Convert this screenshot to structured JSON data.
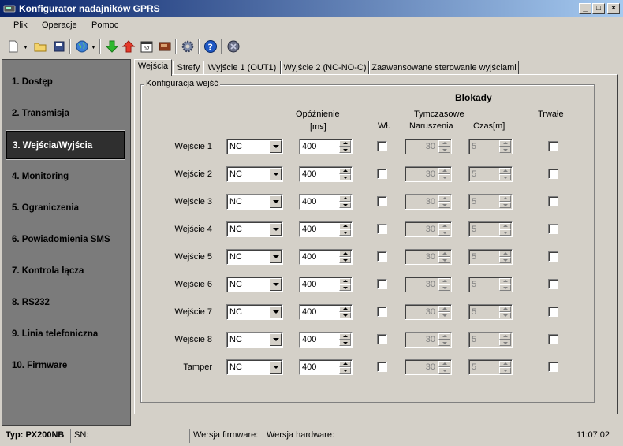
{
  "window": {
    "title": "Konfigurator nadajników GPRS",
    "minimize": "_",
    "maximize": "□",
    "close": "×"
  },
  "menu": [
    "Plik",
    "Operacje",
    "Pomoc"
  ],
  "toolbar": {
    "icons": [
      "new-document-icon",
      "open-folder-icon",
      "save-icon",
      "connect-globe-icon",
      "download-arrow-icon",
      "upload-arrow-icon",
      "calendar-icon",
      "device-icon",
      "settings-gear-icon",
      "help-icon",
      "exit-icon"
    ]
  },
  "sidebar": {
    "items": [
      "1. Dostęp",
      "2. Transmisja",
      "3. Wejścia/Wyjścia",
      "4. Monitoring",
      "5. Ograniczenia",
      "6. Powiadomienia SMS",
      "7. Kontrola łącza",
      "8. RS232",
      "9. Linia telefoniczna",
      "10. Firmware"
    ],
    "active_index": 2
  },
  "tabs": [
    "Wejścia",
    "Strefy",
    "Wyjście 1 (OUT1)",
    "Wyjście 2 (NC-NO-C)",
    "Zaawansowane sterowanie wyjściami"
  ],
  "panel": {
    "group_title": "Konfiguracja wejść",
    "headers": {
      "blokady": "Blokady",
      "opoznienie": "Opóźnienie",
      "ms": "[ms]",
      "wl": "Wł.",
      "tymczasowe": "Tymczasowe",
      "naruszenia": "Naruszenia",
      "czas": "Czas[m]",
      "trwale": "Trwałe"
    },
    "rows": [
      {
        "label": "Wejście 1",
        "type": "NC",
        "delay": "400",
        "naruszenia": "30",
        "czas": "5"
      },
      {
        "label": "Wejście 2",
        "type": "NC",
        "delay": "400",
        "naruszenia": "30",
        "czas": "5"
      },
      {
        "label": "Wejście 3",
        "type": "NC",
        "delay": "400",
        "naruszenia": "30",
        "czas": "5"
      },
      {
        "label": "Wejście 4",
        "type": "NC",
        "delay": "400",
        "naruszenia": "30",
        "czas": "5"
      },
      {
        "label": "Wejście 5",
        "type": "NC",
        "delay": "400",
        "naruszenia": "30",
        "czas": "5"
      },
      {
        "label": "Wejście 6",
        "type": "NC",
        "delay": "400",
        "naruszenia": "30",
        "czas": "5"
      },
      {
        "label": "Wejście 7",
        "type": "NC",
        "delay": "400",
        "naruszenia": "30",
        "czas": "5"
      },
      {
        "label": "Wejście 8",
        "type": "NC",
        "delay": "400",
        "naruszenia": "30",
        "czas": "5"
      },
      {
        "label": "Tamper",
        "type": "NC",
        "delay": "400",
        "naruszenia": "30",
        "czas": "5"
      }
    ]
  },
  "status": {
    "typ": "Typ: PX200NB",
    "sn": "SN:",
    "firmware": "Wersja firmware:",
    "hardware": "Wersja hardware:",
    "time": "11:07:02"
  },
  "colors": {
    "title_start": "#0a246a",
    "title_end": "#a6caf0",
    "sidebar_bg": "#7b7b7b",
    "sidebar_active": "#2f2f2f"
  }
}
